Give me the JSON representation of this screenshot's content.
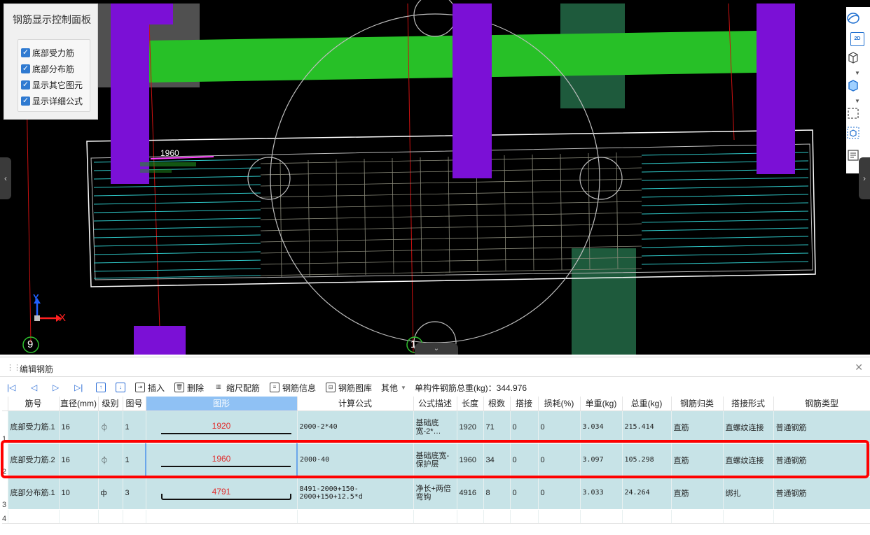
{
  "control_panel": {
    "title": "钢筋显示控制面板",
    "options": [
      {
        "label": "底部受力筋",
        "checked": true
      },
      {
        "label": "底部分布筋",
        "checked": true
      },
      {
        "label": "显示其它图元",
        "checked": true
      },
      {
        "label": "显示详细公式",
        "checked": true
      }
    ]
  },
  "viewport": {
    "dimension_label": "1960",
    "axis_y": "Y",
    "axis_x": "X",
    "grid_marker_left": "9",
    "grid_marker_bottom": "1",
    "right_toolbar_2d": "2D"
  },
  "editor": {
    "title": "编辑钢筋",
    "toolbar": {
      "insert": "插入",
      "delete": "删除",
      "scale_rebar": "缩尺配筋",
      "rebar_info": "钢筋信息",
      "rebar_library": "钢筋图库",
      "other": "其他",
      "total_weight": "单构件钢筋总重(kg)：344.976"
    },
    "columns": [
      "筋号",
      "直径(mm)",
      "级别",
      "图号",
      "图形",
      "计算公式",
      "公式描述",
      "长度",
      "根数",
      "搭接",
      "损耗(%)",
      "单重(kg)",
      "总重(kg)",
      "钢筋归类",
      "搭接形式",
      "钢筋类型"
    ],
    "rows": [
      {
        "index": "1",
        "name": "底部受力筋.1",
        "diameter": "16",
        "grade": "⏀",
        "figure_no": "1",
        "shape_value": "1920",
        "shape": "line",
        "formula": "2000-2*40",
        "desc": "基础底宽-2*…",
        "length": "1920",
        "count": "71",
        "lap": "0",
        "loss": "0",
        "unit_weight": "3.034",
        "total_weight": "215.414",
        "category": "直筋",
        "lap_type": "直螺纹连接",
        "rebar_type": "普通钢筋"
      },
      {
        "index": "2",
        "name": "底部受力筋.2",
        "diameter": "16",
        "grade": "⏀",
        "figure_no": "1",
        "shape_value": "1960",
        "shape": "line",
        "formula": "2000-40",
        "desc": "基础底宽-保护层",
        "length": "1960",
        "count": "34",
        "lap": "0",
        "loss": "0",
        "unit_weight": "3.097",
        "total_weight": "105.298",
        "category": "直筋",
        "lap_type": "直螺纹连接",
        "rebar_type": "普通钢筋"
      },
      {
        "index": "3",
        "name": "底部分布筋.1",
        "diameter": "10",
        "grade": "ф",
        "figure_no": "3",
        "shape_value": "4791",
        "shape": "hook",
        "formula": "8491-2000+150-2000+150+12.5*d",
        "desc": "净长+两倍弯钩",
        "length": "4916",
        "count": "8",
        "lap": "0",
        "loss": "0",
        "unit_weight": "3.033",
        "total_weight": "24.264",
        "category": "直筋",
        "lap_type": "绑扎",
        "rebar_type": "普通钢筋"
      }
    ],
    "empty_row_index": "4"
  },
  "colors": {
    "highlight": "#ff0000",
    "row_bg": "#c7e3e7",
    "selected_header": "#8fc1f4",
    "purple_column": "#7b10d6",
    "green_beam": "#27c027",
    "dark_green": "#1e5a3c"
  }
}
